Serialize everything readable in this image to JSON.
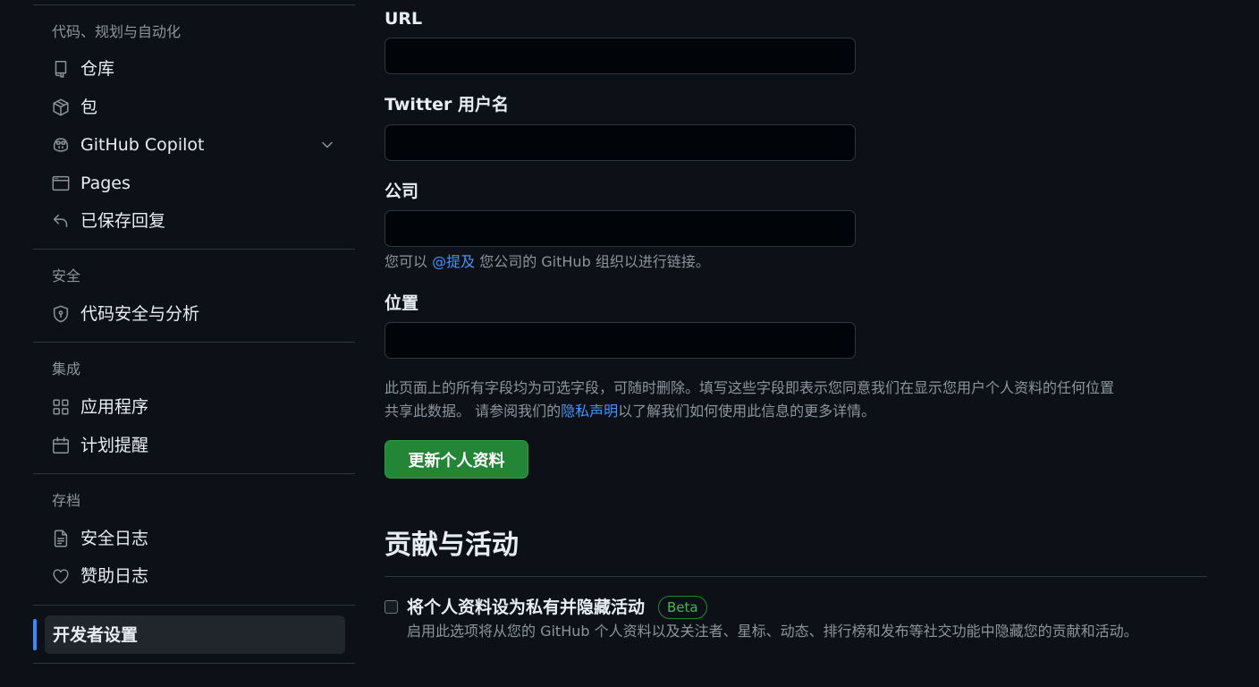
{
  "sidebar": {
    "groups": [
      {
        "label": "代码、规划与自动化",
        "items": [
          {
            "label": "仓库",
            "icon": "repo-icon"
          },
          {
            "label": "包",
            "icon": "package-icon"
          },
          {
            "label": "GitHub Copilot",
            "icon": "copilot-icon",
            "expandable": true
          },
          {
            "label": "Pages",
            "icon": "browser-icon"
          },
          {
            "label": "已保存回复",
            "icon": "reply-icon"
          }
        ]
      },
      {
        "label": "安全",
        "items": [
          {
            "label": "代码安全与分析",
            "icon": "shield-lock-icon"
          }
        ]
      },
      {
        "label": "集成",
        "items": [
          {
            "label": "应用程序",
            "icon": "apps-icon"
          },
          {
            "label": "计划提醒",
            "icon": "calendar-icon"
          }
        ]
      },
      {
        "label": "存档",
        "items": [
          {
            "label": "安全日志",
            "icon": "log-icon"
          },
          {
            "label": "赞助日志",
            "icon": "heart-icon"
          }
        ]
      }
    ],
    "active_item": {
      "label": "开发者设置"
    }
  },
  "form": {
    "url": {
      "label": "URL",
      "value": ""
    },
    "twitter": {
      "label": "Twitter 用户名",
      "value": ""
    },
    "company": {
      "label": "公司",
      "value": "",
      "hint_prefix": "您可以 ",
      "hint_link": "@提及",
      "hint_suffix": " 您公司的 GitHub 组织以进行链接。"
    },
    "location": {
      "label": "位置",
      "value": ""
    },
    "notice_line1": "此页面上的所有字段均为可选字段，可随时删除。填写这些字段即表示您同意我们在显示您用户个人资料的任何位置",
    "notice_line2_prefix": "共享此数据。 请参阅我们的",
    "notice_link": "隐私声明",
    "notice_line2_suffix": "以了解我们如何使用此信息的更多详情。",
    "submit_label": "更新个人资料"
  },
  "contributions": {
    "title": "贡献与活动",
    "private_checkbox": {
      "label": "将个人资料设为私有并隐藏活动",
      "badge": "Beta",
      "description": "启用此选项将从您的 GitHub 个人资料以及关注者、星标、动态、排行榜和发布等社交功能中隐藏您的贡献和活动。",
      "checked": false
    }
  },
  "colors": {
    "background": "#0d1117",
    "accent_blue": "#4493f8",
    "button_green": "#238636",
    "badge_green": "#3fb950"
  }
}
